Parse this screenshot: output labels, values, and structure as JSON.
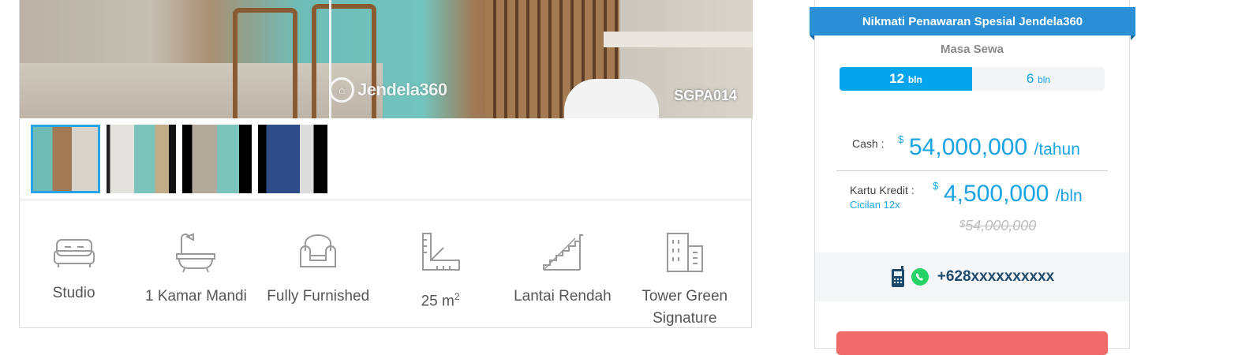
{
  "gallery": {
    "watermark": "Jendela360",
    "code": "SGPA014",
    "thumbnails": [
      "thumbnail-1",
      "thumbnail-2",
      "thumbnail-3",
      "thumbnail-4"
    ]
  },
  "features": {
    "type": "Studio",
    "bathroom": "1 Kamar Mandi",
    "furnish": "Fully Furnished",
    "size_value": "25 m",
    "size_unit_sup": "2",
    "floor": "Lantai Rendah",
    "tower_line1": "Tower Green",
    "tower_line2": "Signature"
  },
  "pricing": {
    "ribbon": "Nikmati Penawaran Spesial Jendela360",
    "period_label": "Masa Sewa",
    "toggle": {
      "option1_num": "12",
      "option1_unit": "bln",
      "option2_num": "6",
      "option2_unit": "bln",
      "selected": "12"
    },
    "cash_label": "Cash :",
    "currency": "$",
    "cash_price": "54,000,000",
    "cash_per": "/tahun",
    "credit_label": "Kartu Kredit :",
    "credit_sub": "Cicilan 12x",
    "credit_price": "4,500,000",
    "credit_per": "/bln",
    "original_price": "54,000,000",
    "phone": "+628xxxxxxxxxx"
  },
  "colors": {
    "accent": "#1aa4e3",
    "ribbon": "#2b8fd5",
    "cta": "#f06a6a",
    "whatsapp": "#25d366",
    "phone_text": "#1f4a6e"
  }
}
